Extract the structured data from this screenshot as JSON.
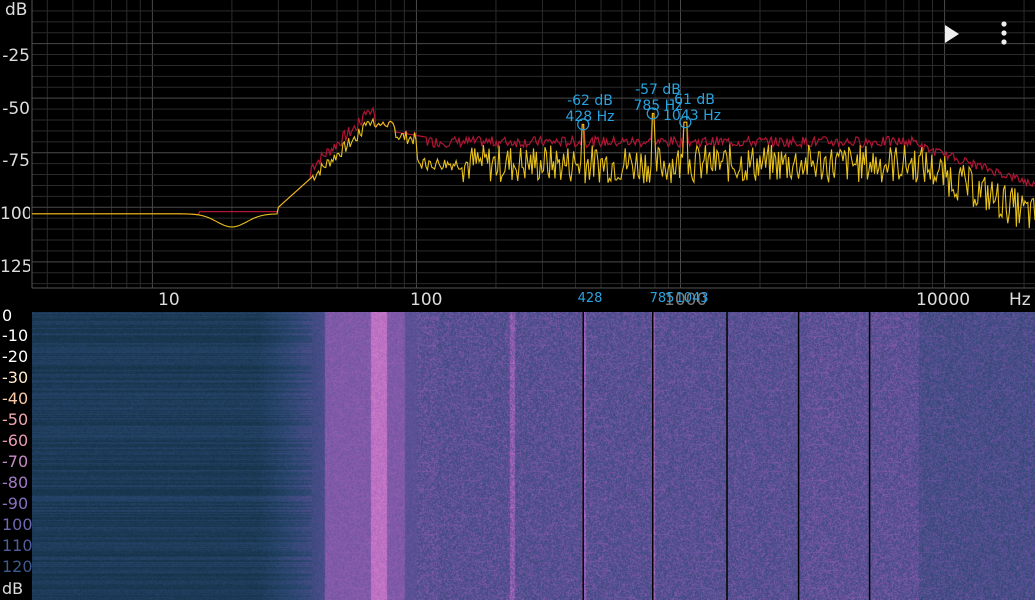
{
  "spectrum": {
    "y_unit": "dB",
    "x_unit": "Hz",
    "y_ticks": [
      "-25",
      "-50",
      "-75",
      "100",
      "125"
    ],
    "x_ticks": [
      "10",
      "100",
      "10000"
    ],
    "peaks": [
      {
        "db_label": "-62 dB",
        "hz_label": "428 Hz",
        "db": -62,
        "hz": 428
      },
      {
        "db_label": "-57 dB",
        "hz_label": "785 Hz",
        "db": -57,
        "hz": 785
      },
      {
        "db_label": "-61 dB",
        "hz_label": "1043 Hz",
        "db": -61,
        "hz": 1043
      }
    ],
    "colors": {
      "current": "#e8c21a",
      "peak_hold": "#b01535",
      "marker": "#29a3e0",
      "grid": "#2b2b2b"
    }
  },
  "spectrogram": {
    "marker_labels": [
      "428",
      "785",
      "1043"
    ],
    "marker_hz": [
      428,
      785,
      1043
    ],
    "partial_axis_label": "1000",
    "db_scale": [
      "0",
      "-10",
      "-20",
      "-30",
      "-40",
      "-50",
      "-60",
      "-70",
      "-80",
      "-90",
      "100",
      "110",
      "120"
    ],
    "db_unit": "dB",
    "db_colors": [
      "#ffffff",
      "#ffffff",
      "#ffffff",
      "#ffeacb",
      "#f7c9a6",
      "#f1a7ad",
      "#e89bb8",
      "#c98ac8",
      "#a27ac8",
      "#8770c0",
      "#6c68b2",
      "#4e5f9e",
      "#3d5a8e"
    ]
  },
  "controls": {
    "play": "play-icon",
    "menu": "more-vert-icon"
  }
}
